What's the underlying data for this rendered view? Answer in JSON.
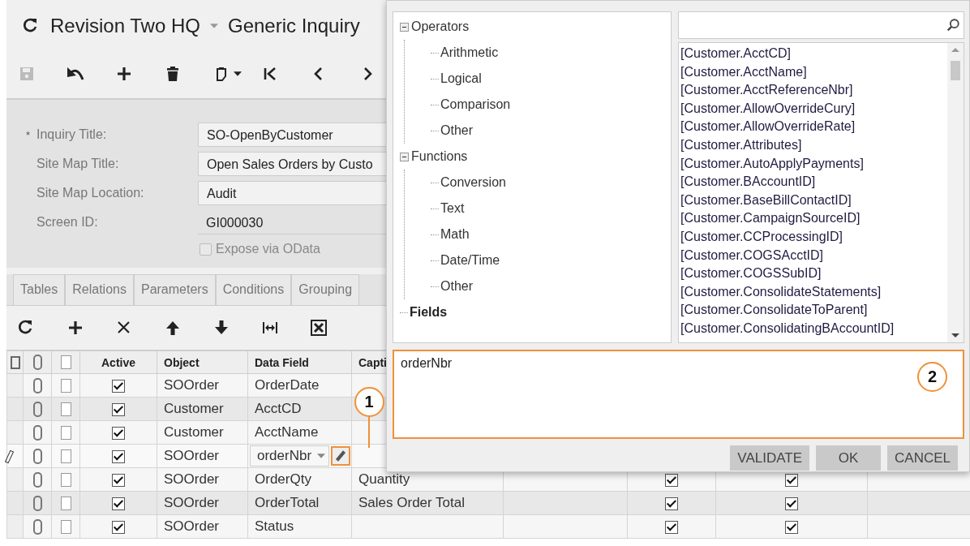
{
  "header": {
    "company": "Revision Two HQ",
    "screen": "Generic Inquiry"
  },
  "toolbar": [
    {
      "kind": "save",
      "disabled": true
    },
    {
      "kind": "undo",
      "disabled": false
    },
    {
      "kind": "add",
      "disabled": false
    },
    {
      "kind": "delete",
      "disabled": false
    },
    {
      "kind": "clipboard",
      "disabled": false
    },
    {
      "kind": "first",
      "disabled": false
    },
    {
      "kind": "previous",
      "disabled": false
    },
    {
      "kind": "next",
      "disabled": false
    }
  ],
  "form": [
    {
      "kind": "input",
      "marker": "*",
      "label": "Inquiry Title:",
      "value": "SO-OpenByCustomer"
    },
    {
      "kind": "input",
      "label": "Site Map Title:",
      "value": "Open Sales Orders by Custo"
    },
    {
      "kind": "input",
      "label": "Site Map Location:",
      "value": "Audit"
    },
    {
      "kind": "readonly",
      "label": "Screen ID:",
      "value": "GI000030"
    },
    {
      "kind": "checkbox",
      "label": "Expose via OData",
      "checked": false,
      "disabled": true
    }
  ],
  "tabs": [
    {
      "label": "Tables",
      "selected": false
    },
    {
      "label": "Relations",
      "selected": false
    },
    {
      "label": "Parameters",
      "selected": false
    },
    {
      "label": "Conditions",
      "selected": false
    },
    {
      "label": "Grouping",
      "selected": false
    }
  ],
  "grid_toolbar": [
    {
      "kind": "refresh"
    },
    {
      "kind": "add"
    },
    {
      "kind": "delete"
    },
    {
      "kind": "up"
    },
    {
      "kind": "down"
    },
    {
      "kind": "fit"
    },
    {
      "kind": "excel"
    }
  ],
  "grid": {
    "columns": [
      "Active",
      "Object",
      "Data Field",
      "Capti"
    ],
    "rows": [
      {
        "editing": false,
        "active": true,
        "object": "SOOrder",
        "data_field": "OrderDate"
      },
      {
        "editing": false,
        "active": true,
        "object": "Customer",
        "data_field": "AcctCD"
      },
      {
        "editing": false,
        "active": true,
        "object": "Customer",
        "data_field": "AcctName"
      },
      {
        "editing": true,
        "active": true,
        "object": "SOOrder",
        "data_field": "orderNbr"
      },
      {
        "editing": false,
        "active": true,
        "object": "SOOrder",
        "data_field": "OrderQty",
        "caption": "Quantity",
        "column_8": true,
        "column_9": true
      },
      {
        "editing": false,
        "active": true,
        "object": "SOOrder",
        "data_field": "OrderTotal",
        "caption": "Sales Order Total",
        "column_8": true,
        "column_9": true
      },
      {
        "editing": false,
        "active": true,
        "object": "SOOrder",
        "data_field": "Status",
        "column_8": true,
        "column_9": true
      }
    ]
  },
  "dialog": {
    "tree": [
      {
        "label": "Operators",
        "expanded": true,
        "selected": false,
        "children": [
          {
            "label": "Arithmetic",
            "selected": false
          },
          {
            "label": "Logical",
            "selected": false
          },
          {
            "label": "Comparison",
            "selected": false
          },
          {
            "label": "Other",
            "selected": false
          }
        ]
      },
      {
        "label": "Functions",
        "expanded": true,
        "selected": false,
        "children": [
          {
            "label": "Conversion",
            "selected": false
          },
          {
            "label": "Text",
            "selected": false
          },
          {
            "label": "Math",
            "selected": false
          },
          {
            "label": "Date/Time",
            "selected": false
          },
          {
            "label": "Other",
            "selected": false
          }
        ]
      },
      {
        "label": "Fields",
        "selected": true
      }
    ],
    "fields": [
      "[Customer.AcctCD]",
      "[Customer.AcctName]",
      "[Customer.AcctReferenceNbr]",
      "[Customer.AllowOverrideCury]",
      "[Customer.AllowOverrideRate]",
      "[Customer.Attributes]",
      "[Customer.AutoApplyPayments]",
      "[Customer.BAccountID]",
      "[Customer.BaseBillContactID]",
      "[Customer.CampaignSourceID]",
      "[Customer.CCProcessingID]",
      "[Customer.COGSAcctID]",
      "[Customer.COGSSubID]",
      "[Customer.ConsolidateStatements]",
      "[Customer.ConsolidateToParent]",
      "[Customer.ConsolidatingBAccountID]"
    ],
    "expression": "orderNbr",
    "buttons": [
      "VALIDATE",
      "OK",
      "CANCEL"
    ]
  },
  "callouts": [
    {
      "label": "1"
    },
    {
      "label": "2"
    }
  ]
}
